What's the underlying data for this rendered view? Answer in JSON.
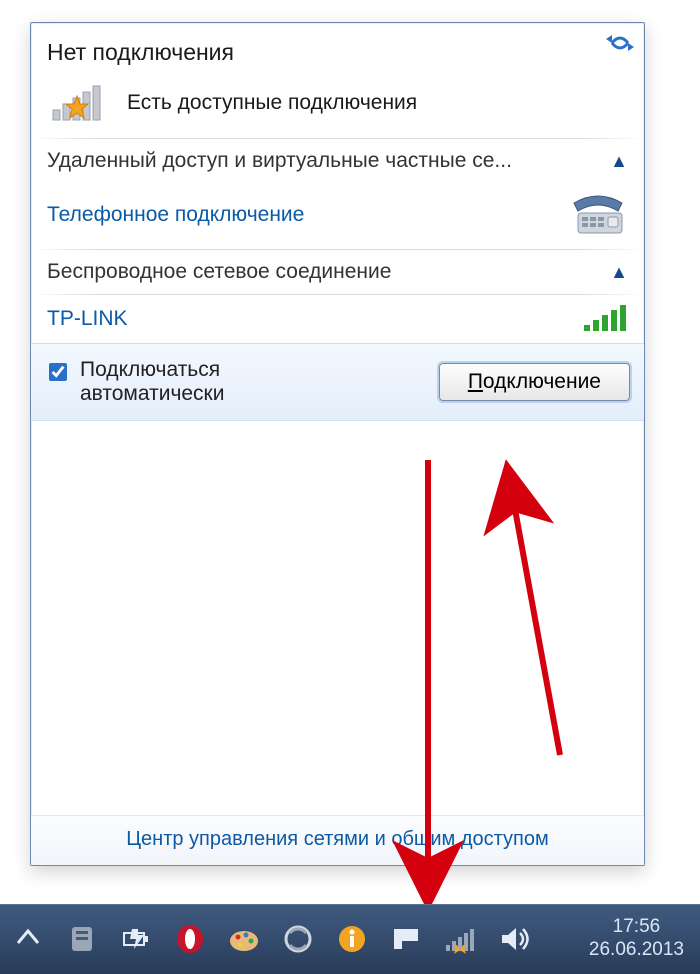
{
  "header": {
    "title": "Нет подключения",
    "available_text": "Есть доступные подключения"
  },
  "sections": {
    "dialup_vpn_title": "Удаленный доступ и виртуальные частные се...",
    "dialup_item": "Телефонное подключение",
    "wireless_title": "Беспроводное сетевое соединение"
  },
  "wifi": {
    "ssid": "TP-LINK",
    "auto_connect_label": "Подключаться автоматически",
    "connect_button_prefix": "П",
    "connect_button_rest": "одключение"
  },
  "footer": {
    "link": "Центр управления сетями и общим доступом"
  },
  "taskbar": {
    "time": "17:56",
    "date": "26.06.2013"
  }
}
